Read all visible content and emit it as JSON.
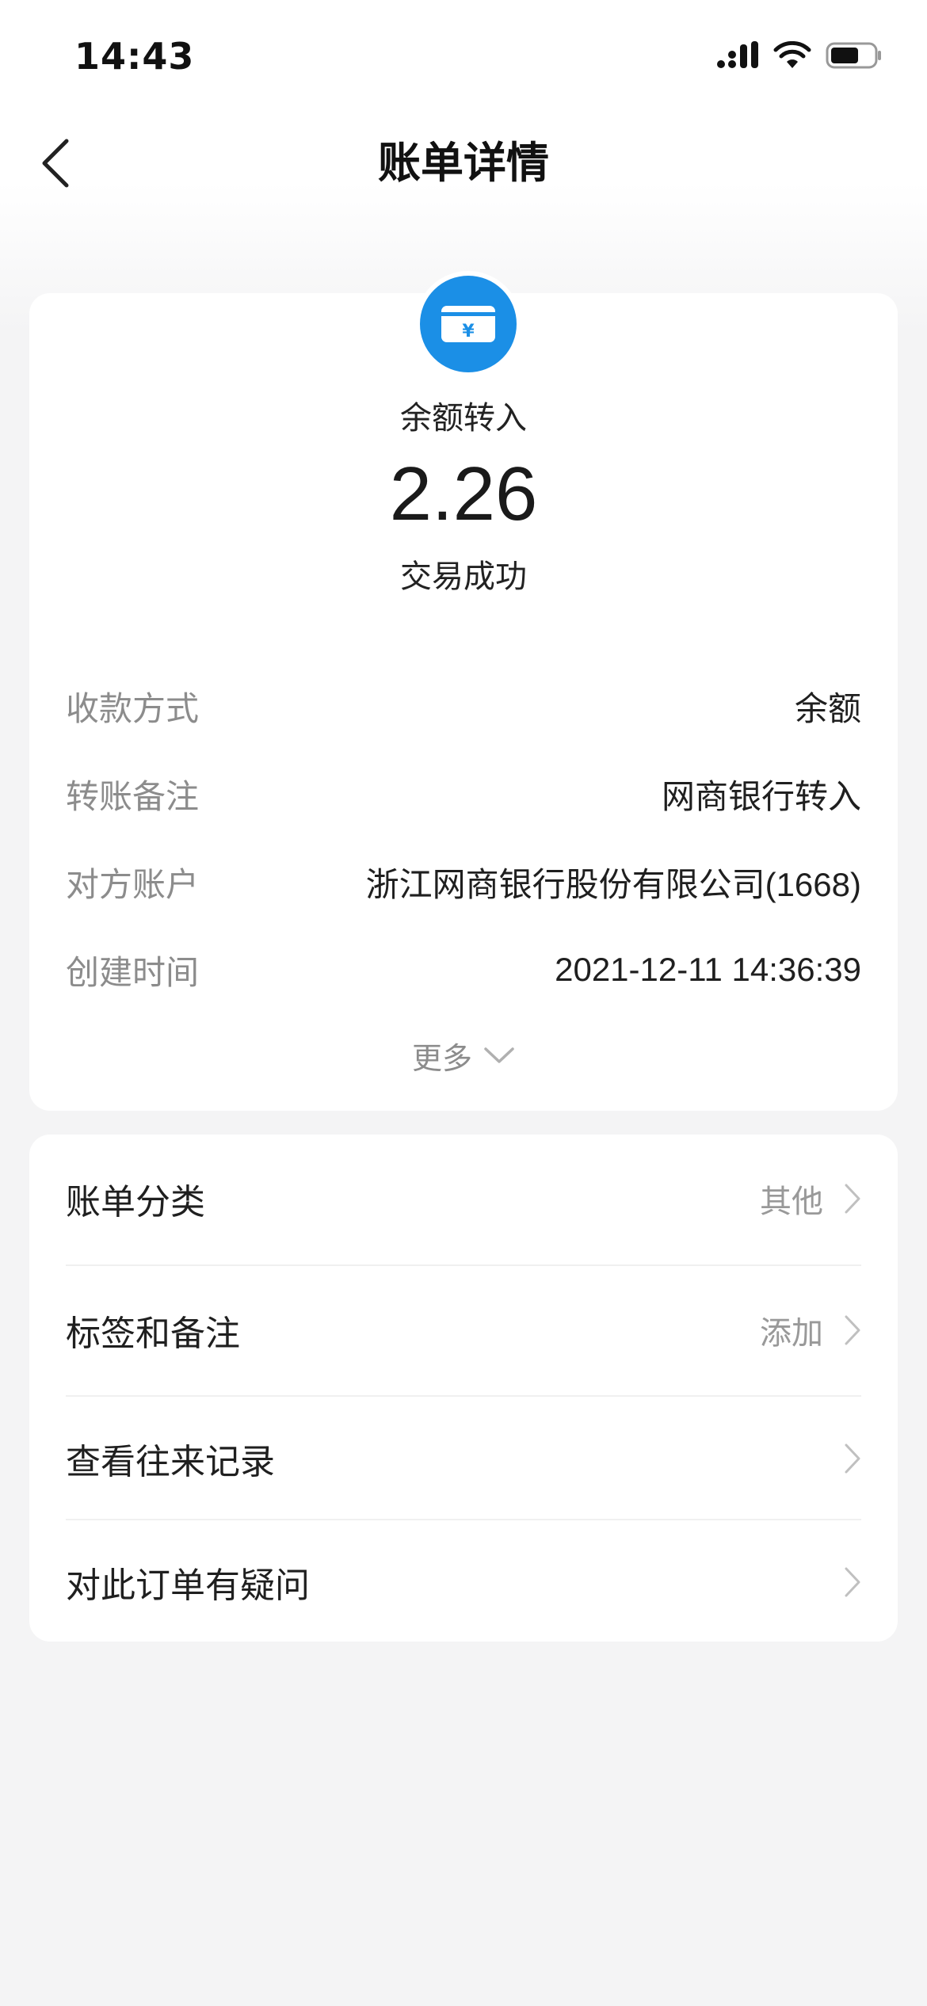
{
  "status_bar": {
    "time": "14:43"
  },
  "nav": {
    "title": "账单详情"
  },
  "summary": {
    "type": "余额转入",
    "amount": "2.26",
    "status": "交易成功",
    "icon_color": "#1b8fe6",
    "icon": "card-yuan-icon",
    "icon_glyph": "¥"
  },
  "details": [
    {
      "label": "收款方式",
      "value": "余额"
    },
    {
      "label": "转账备注",
      "value": "网商银行转入"
    },
    {
      "label": "对方账户",
      "value": "浙江网商银行股份有限公司(1668)"
    },
    {
      "label": "创建时间",
      "value": "2021-12-11 14:36:39"
    }
  ],
  "more": {
    "label": "更多"
  },
  "menu": [
    {
      "label": "账单分类",
      "value": "其他"
    },
    {
      "label": "标签和备注",
      "value": "添加"
    },
    {
      "label": "查看往来记录",
      "value": ""
    },
    {
      "label": "对此订单有疑问",
      "value": ""
    }
  ]
}
